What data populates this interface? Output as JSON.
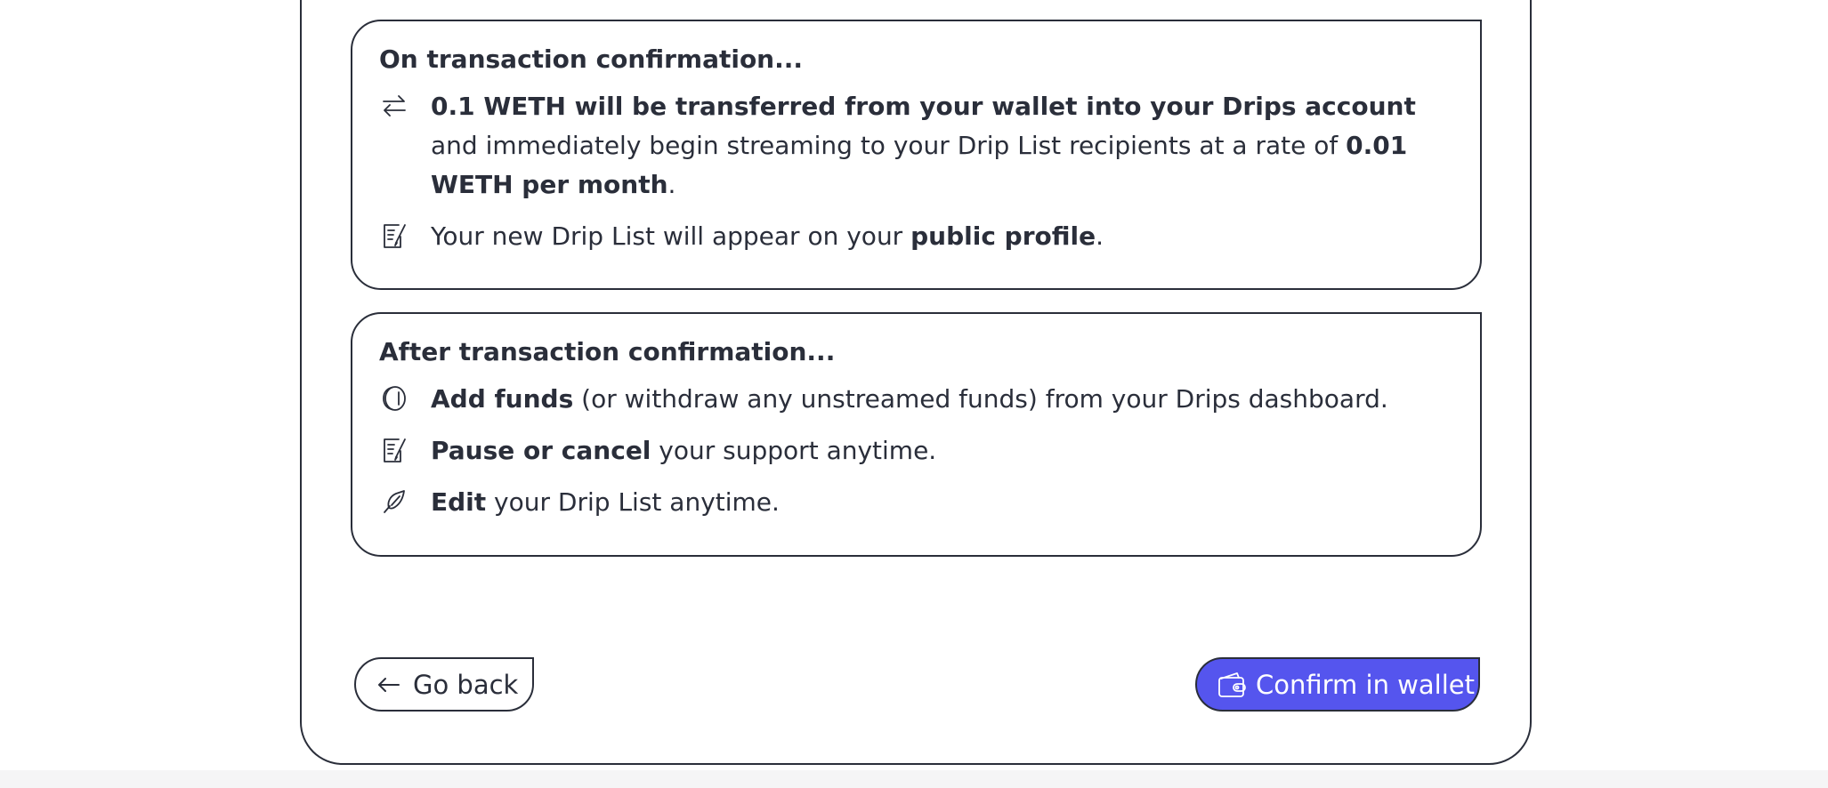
{
  "on_confirmation": {
    "title": "On transaction confirmation...",
    "items": [
      {
        "icon": "transfer-arrows-icon",
        "bold1": "0.1 WETH will be transferred from your wallet into your Drips account",
        "text1": " and immediately begin streaming to your Drip List recipients at a rate of ",
        "bold2": "0.01 WETH per month",
        "text2": "."
      },
      {
        "icon": "drip-list-icon",
        "text1": "Your new Drip List will appear on your ",
        "bold1": "public profile",
        "text2": "."
      }
    ]
  },
  "after_confirmation": {
    "title": "After transaction confirmation...",
    "items": [
      {
        "icon": "coin-icon",
        "bold1": "Add funds",
        "text1": " (or withdraw any unstreamed funds) from your Drips dashboard."
      },
      {
        "icon": "drip-list-icon",
        "bold1": "Pause or cancel",
        "text1": " your support anytime."
      },
      {
        "icon": "pen-icon",
        "bold1": "Edit",
        "text1": " your Drip List anytime."
      }
    ]
  },
  "actions": {
    "back_label": "Go back",
    "back_icon": "arrow-left-icon",
    "confirm_label": "Confirm in wallet",
    "confirm_icon": "wallet-icon"
  },
  "colors": {
    "primary": "#5555ee",
    "foreground": "#2a2e3a",
    "background": "#ffffff"
  }
}
